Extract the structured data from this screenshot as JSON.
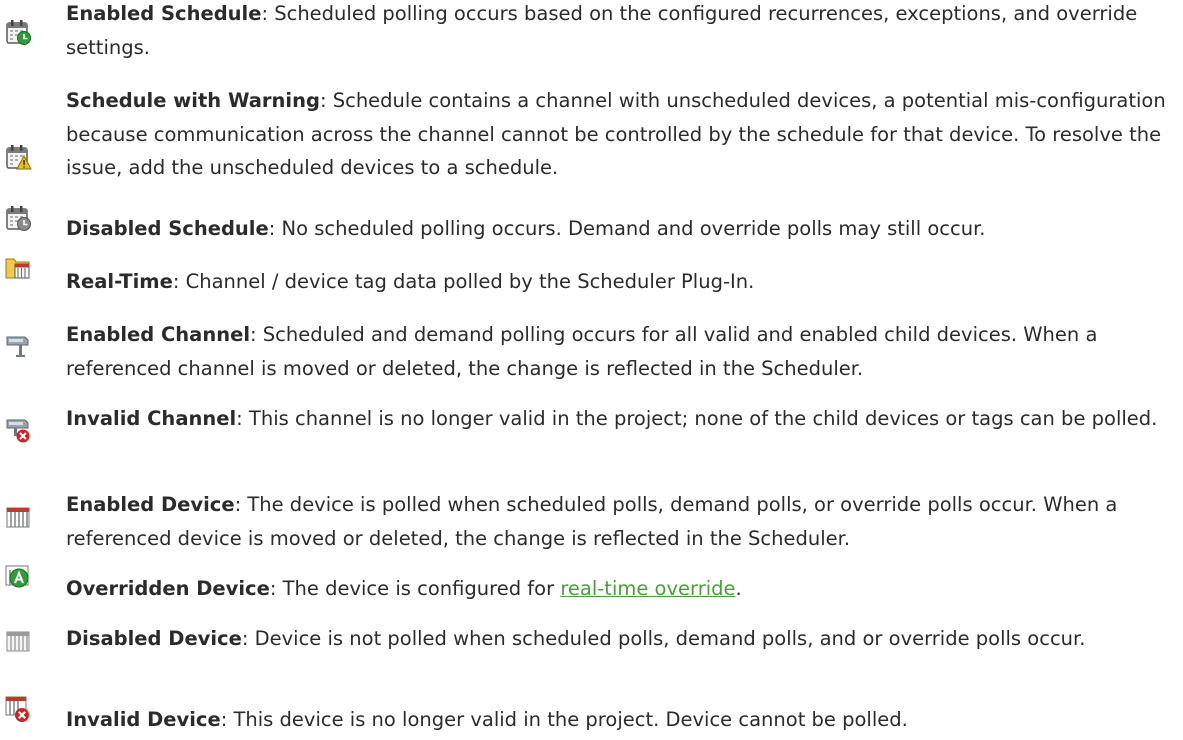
{
  "items": [
    {
      "icon": "enabled-schedule-icon",
      "term": "Enabled Schedule",
      "desc": ": Scheduled polling occurs based on the configured recurrences, exceptions, and override settings."
    },
    {
      "icon": "schedule-warning-icon",
      "term": "Schedule with Warning",
      "desc": ": Schedule contains a channel with unscheduled devices, a potential mis-configuration because communication across the channel cannot be controlled by the schedule for that device. To resolve the issue, add the unscheduled devices to a schedule."
    },
    {
      "icon": "disabled-schedule-icon",
      "term": "Disabled Schedule",
      "desc": ": No scheduled polling occurs. Demand and override polls may still occur."
    },
    {
      "icon": "real-time-icon",
      "term": "Real-Time",
      "desc": ": Channel / device tag data polled by the Scheduler Plug-In."
    },
    {
      "icon": "enabled-channel-icon",
      "term": "Enabled Channel",
      "desc": ": Scheduled and demand polling occurs for all valid and enabled child devices. When a referenced channel is moved or deleted, the change is reflected in the Scheduler."
    },
    {
      "icon": "invalid-channel-icon",
      "term": "Invalid Channel",
      "desc": ": This channel is no longer valid in the project; none of the child devices or tags can be polled."
    },
    {
      "icon": "enabled-device-icon",
      "term": "Enabled Device",
      "desc": ": The device is polled when scheduled polls, demand polls, or override polls occur. When a referenced device is moved or deleted, the change is reflected in the Scheduler."
    },
    {
      "icon": "overridden-device-icon",
      "term": "Overridden Device",
      "desc": ": The device is configured for ",
      "link": "real-time override",
      "after": "."
    },
    {
      "icon": "disabled-device-icon",
      "term": "Disabled Device",
      "desc": ": Device is not polled when scheduled polls, demand polls, and or override polls occur."
    },
    {
      "icon": "invalid-device-icon",
      "term": "Invalid Device",
      "desc": ": This device is no longer valid in the project. Device cannot be polled."
    }
  ],
  "colors": {
    "link": "#4aa13c",
    "text": "#2b2b2b",
    "enabled": "#2e9e3a",
    "invalid": "#d42020",
    "warning": "#e8c21a"
  }
}
